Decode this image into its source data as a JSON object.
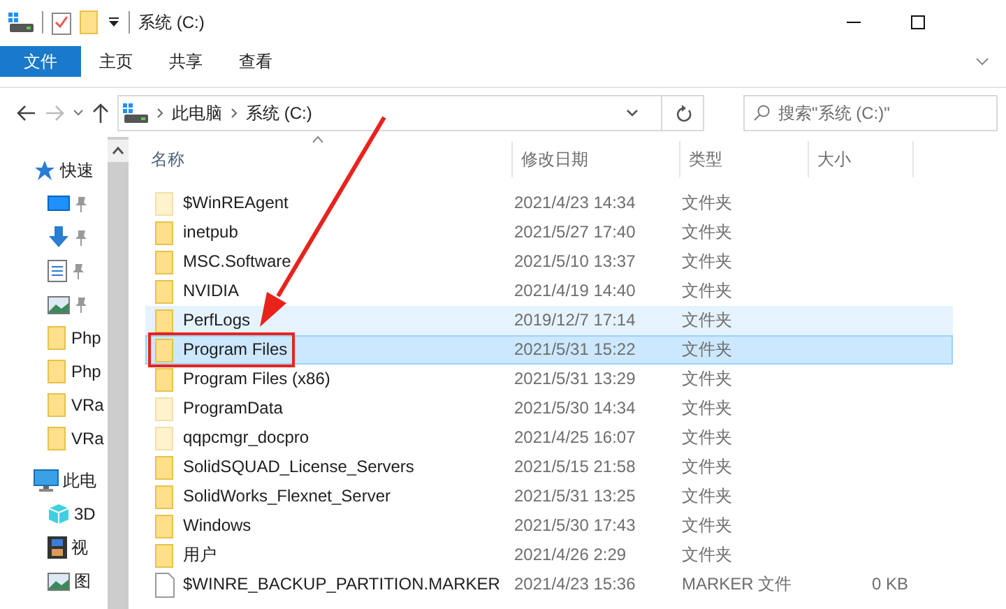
{
  "window": {
    "title": "系统 (C:)"
  },
  "ribbon_tabs": [
    {
      "label": "文件",
      "selected": true
    },
    {
      "label": "主页",
      "selected": false
    },
    {
      "label": "共享",
      "selected": false
    },
    {
      "label": "查看",
      "selected": false
    }
  ],
  "address": {
    "crumbs": [
      "此电脑",
      "系统 (C:)"
    ]
  },
  "search": {
    "placeholder": "搜索\"系统 (C:)\""
  },
  "sidebar": {
    "items": [
      {
        "kind": "star",
        "label": "快速"
      },
      {
        "kind": "desktop",
        "pinned": true
      },
      {
        "kind": "download",
        "pinned": true
      },
      {
        "kind": "document",
        "pinned": true
      },
      {
        "kind": "image",
        "pinned": true
      },
      {
        "kind": "folder",
        "label": "Php"
      },
      {
        "kind": "folder",
        "label": "Php"
      },
      {
        "kind": "folder",
        "label": "VRa"
      },
      {
        "kind": "folder",
        "label": "VRa"
      },
      {
        "kind": "computer",
        "label": "此电"
      },
      {
        "kind": "cube",
        "label": "3D"
      },
      {
        "kind": "video",
        "label": "视"
      },
      {
        "kind": "image",
        "label": "图"
      }
    ]
  },
  "table": {
    "columns": [
      "名称",
      "修改日期",
      "类型",
      "大小"
    ],
    "rows": [
      {
        "kind": "hidden-folder",
        "name": "$WinREAgent",
        "modified": "2021/4/23 14:34",
        "type": "文件夹",
        "selected": false,
        "hovered": false,
        "marked": false
      },
      {
        "kind": "folder",
        "name": "inetpub",
        "modified": "2021/5/27 17:40",
        "type": "文件夹",
        "selected": false,
        "hovered": false,
        "marked": false
      },
      {
        "kind": "folder",
        "name": "MSC.Software",
        "modified": "2021/5/10 13:37",
        "type": "文件夹",
        "selected": false,
        "hovered": false,
        "marked": false
      },
      {
        "kind": "folder",
        "name": "NVIDIA",
        "modified": "2021/4/19 14:40",
        "type": "文件夹",
        "selected": false,
        "hovered": false,
        "marked": false
      },
      {
        "kind": "folder",
        "name": "PerfLogs",
        "modified": "2019/12/7 17:14",
        "type": "文件夹",
        "selected": false,
        "hovered": true,
        "marked": false
      },
      {
        "kind": "folder",
        "name": "Program Files",
        "modified": "2021/5/31 15:22",
        "type": "文件夹",
        "selected": true,
        "hovered": false,
        "marked": true
      },
      {
        "kind": "folder",
        "name": "Program Files (x86)",
        "modified": "2021/5/31 13:29",
        "type": "文件夹",
        "selected": false,
        "hovered": false,
        "marked": false
      },
      {
        "kind": "hidden-folder",
        "name": "ProgramData",
        "modified": "2021/5/30 14:34",
        "type": "文件夹",
        "selected": false,
        "hovered": false,
        "marked": false
      },
      {
        "kind": "hidden-folder",
        "name": "qqpcmgr_docpro",
        "modified": "2021/4/25 16:07",
        "type": "文件夹",
        "selected": false,
        "hovered": false,
        "marked": false
      },
      {
        "kind": "folder",
        "name": "SolidSQUAD_License_Servers",
        "modified": "2021/5/15 21:58",
        "type": "文件夹",
        "selected": false,
        "hovered": false,
        "marked": false
      },
      {
        "kind": "folder",
        "name": "SolidWorks_Flexnet_Server",
        "modified": "2021/5/31 13:25",
        "type": "文件夹",
        "selected": false,
        "hovered": false,
        "marked": false
      },
      {
        "kind": "folder",
        "name": "Windows",
        "modified": "2021/5/30 17:43",
        "type": "文件夹",
        "selected": false,
        "hovered": false,
        "marked": false
      },
      {
        "kind": "folder",
        "name": "用户",
        "modified": "2021/4/26 2:29",
        "type": "文件夹",
        "selected": false,
        "hovered": false,
        "marked": false
      },
      {
        "kind": "file",
        "name": "$WINRE_BACKUP_PARTITION.MARKER",
        "modified": "2021/4/23 15:36",
        "type": "MARKER 文件",
        "size": "0 KB",
        "selected": false,
        "hovered": false,
        "marked": false
      }
    ]
  }
}
